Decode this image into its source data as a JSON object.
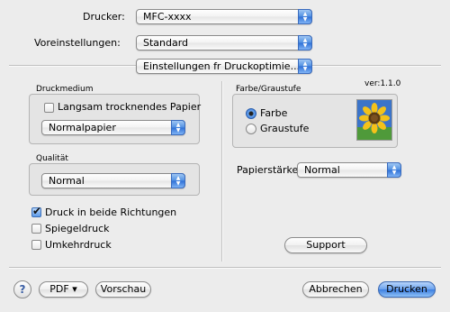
{
  "header": {
    "printer_label": "Drucker:",
    "printer_value": "MFC-xxxx",
    "presets_label": "Voreinstellungen:",
    "presets_value": "Standard",
    "panel_value": "Einstellungen fr Druckoptimie..."
  },
  "media": {
    "group_label": "Druckmedium",
    "slow_dry_label": "Langsam trocknendes Papier",
    "slow_dry_checked": false,
    "media_type_value": "Normalpapier"
  },
  "quality": {
    "group_label": "Qualität",
    "value": "Normal"
  },
  "options": {
    "bidirectional_label": "Druck in beide Richtungen",
    "bidirectional_checked": true,
    "mirror_label": "Spiegeldruck",
    "mirror_checked": false,
    "reverse_label": "Umkehrdruck",
    "reverse_checked": false
  },
  "color": {
    "version": "ver:1.1.0",
    "group_label": "Farbe/Graustufe",
    "color_label": "Farbe",
    "gray_label": "Graustufe",
    "selected": "Farbe"
  },
  "paper": {
    "thickness_label": "Papierstärke:",
    "thickness_value": "Normal"
  },
  "buttons": {
    "support": "Support",
    "help": "?",
    "pdf": "PDF ▾",
    "preview": "Vorschau",
    "cancel": "Abbrechen",
    "print": "Drucken"
  },
  "colors": {
    "accent": "#3c7ee0",
    "window_bg": "#ececec"
  }
}
